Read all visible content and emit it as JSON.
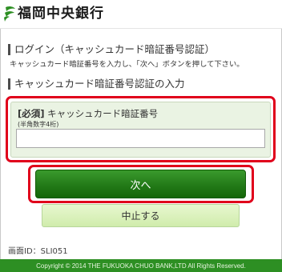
{
  "header": {
    "bank_name": "福岡中央銀行"
  },
  "login": {
    "title": "ログイン（キャッシュカード暗証番号認証）",
    "description": "キャッシュカード暗証番号を入力し、「次へ」ボタンを押して下さい。"
  },
  "pin_section": {
    "title": "キャッシュカード暗証番号認証の入力",
    "required_tag": "[必須]",
    "field_label": "キャッシュカード暗証番号",
    "field_hint": "(半角数字4桁)",
    "value": ""
  },
  "buttons": {
    "next": "次へ",
    "cancel": "中止する"
  },
  "screen_id": "画面ID：SLI051",
  "footer": {
    "copyright": "Copyright © 2014 THE FUKUOKA CHUO BANK,LTD All Rights Reserved."
  },
  "colors": {
    "brand_green": "#2d8f23",
    "highlight_red": "#e0001b"
  }
}
